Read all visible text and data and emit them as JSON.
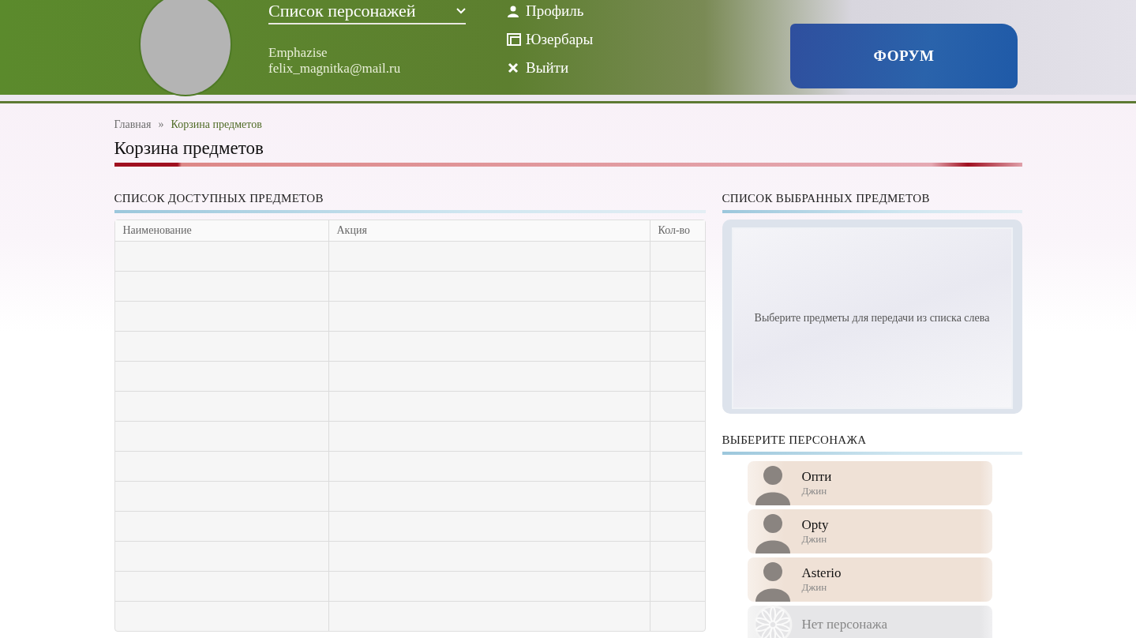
{
  "header": {
    "character_select": {
      "label": "Список персонажей"
    },
    "account": {
      "name": "Emphazise",
      "email": "felix_magnitka@mail.ru"
    },
    "links": [
      {
        "kind": "profile",
        "label": "Профиль"
      },
      {
        "kind": "userbars",
        "label": "Юзербары"
      },
      {
        "kind": "logout",
        "label": "Выйти"
      }
    ],
    "forum_button": "ФОРУМ"
  },
  "breadcrumbs": [
    {
      "label": "Главная",
      "current": false
    },
    {
      "label": "Корзина предметов",
      "current": true
    }
  ],
  "breadcrumb_separator": "»",
  "page_title": "Корзина предметов",
  "available_items": {
    "heading": "СПИСОК ДОСТУПНЫХ ПРЕДМЕТОВ",
    "columns": [
      "Наименование",
      "Акция",
      "Кол-во"
    ]
  },
  "selected_items": {
    "heading": "СПИСОК ВЫБРАННЫХ ПРЕДМЕТОВ",
    "empty_text": "Выберите предметы для передачи из списка слева"
  },
  "characters": {
    "heading": "ВЫБЕРИТЕ ПЕРСОНАЖА",
    "items": [
      {
        "kind": "character",
        "name": "Опти",
        "race": "Джин"
      },
      {
        "kind": "character",
        "name": "Opty",
        "race": "Джин"
      },
      {
        "kind": "character",
        "name": "Asterio",
        "race": "Джин"
      },
      {
        "kind": "empty",
        "name": "Нет персонажа"
      }
    ]
  }
}
